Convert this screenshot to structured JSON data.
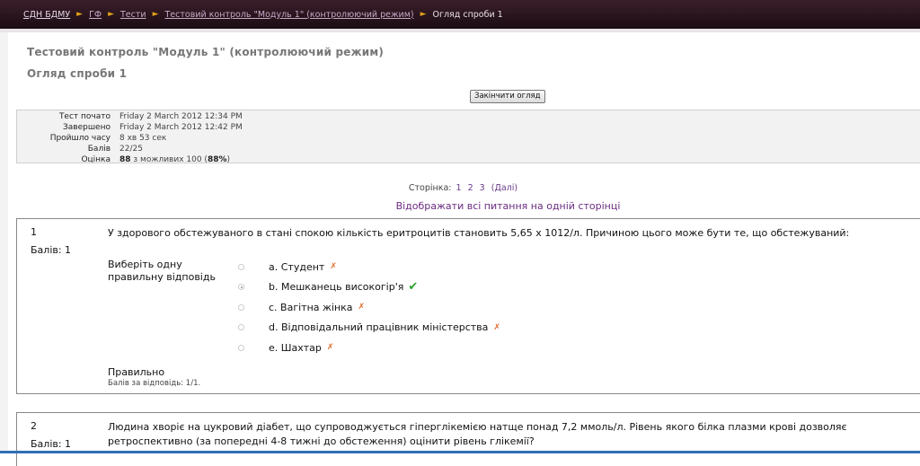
{
  "breadcrumb": {
    "items": [
      "СДН БДМУ",
      "ГФ",
      "Тести",
      "Тестовий контроль \"Модуль 1\" (контролюючий режим)"
    ],
    "current": "Огляд спроби 1",
    "separator": "►"
  },
  "page": {
    "title": "Тестовий контроль \"Модуль 1\" (контролюючий режим)",
    "subtitle": "Огляд спроби 1",
    "finish_button": "Закінчити огляд"
  },
  "summary": {
    "rows": [
      {
        "label": "Тест почато",
        "value": "Friday 2 March 2012 12:34 PM"
      },
      {
        "label": "Завершено",
        "value": "Friday 2 March 2012 12:42 PM"
      },
      {
        "label": "Пройшло часу",
        "value": "8 хв 53 сек"
      },
      {
        "label": "Балів",
        "value": "22/25"
      }
    ],
    "grade_label": "Оцінка",
    "grade_value": "88",
    "grade_rest": " з можливих 100 (",
    "grade_percent": "88%",
    "grade_close": ")"
  },
  "pager": {
    "label": "Сторінка:",
    "pages": [
      "1",
      "2",
      "3"
    ],
    "next": "(Далі)"
  },
  "show_all_link": "Відображати всі питання на одній сторінці",
  "questions": [
    {
      "number": "1",
      "grade": "Балів: 1",
      "text": "У здорового обстежуваного в стані спокою кількість еритроцитів становить 5,65 х 1012/л. Причиною цього може бути те, що обстежуваний:",
      "prompt": "Виберіть одну правильну відповідь",
      "answers": [
        {
          "label": "a. Студент",
          "mark": "✗"
        },
        {
          "label": "b. Мешканець високогір'я",
          "mark": "✔"
        },
        {
          "label": "c. Вагітна жінка",
          "mark": "✗"
        },
        {
          "label": "d. Відповідальний працівник міністерства",
          "mark": "✗"
        },
        {
          "label": "e. Шахтар",
          "mark": "✗"
        }
      ],
      "result": "Правильно",
      "points": "Балів за відповідь: 1/1."
    },
    {
      "number": "2",
      "grade": "Балів: 1",
      "text": "Людина хворіє на цукровий діабет, що супроводжується гіперглікемією натще понад 7,2 ммоль/л. Рівень якого білка плазми крові дозволяє ретроспективно (за попередні 4-8 тижні до обстеження) оцінити рівень глікемії?"
    }
  ]
}
